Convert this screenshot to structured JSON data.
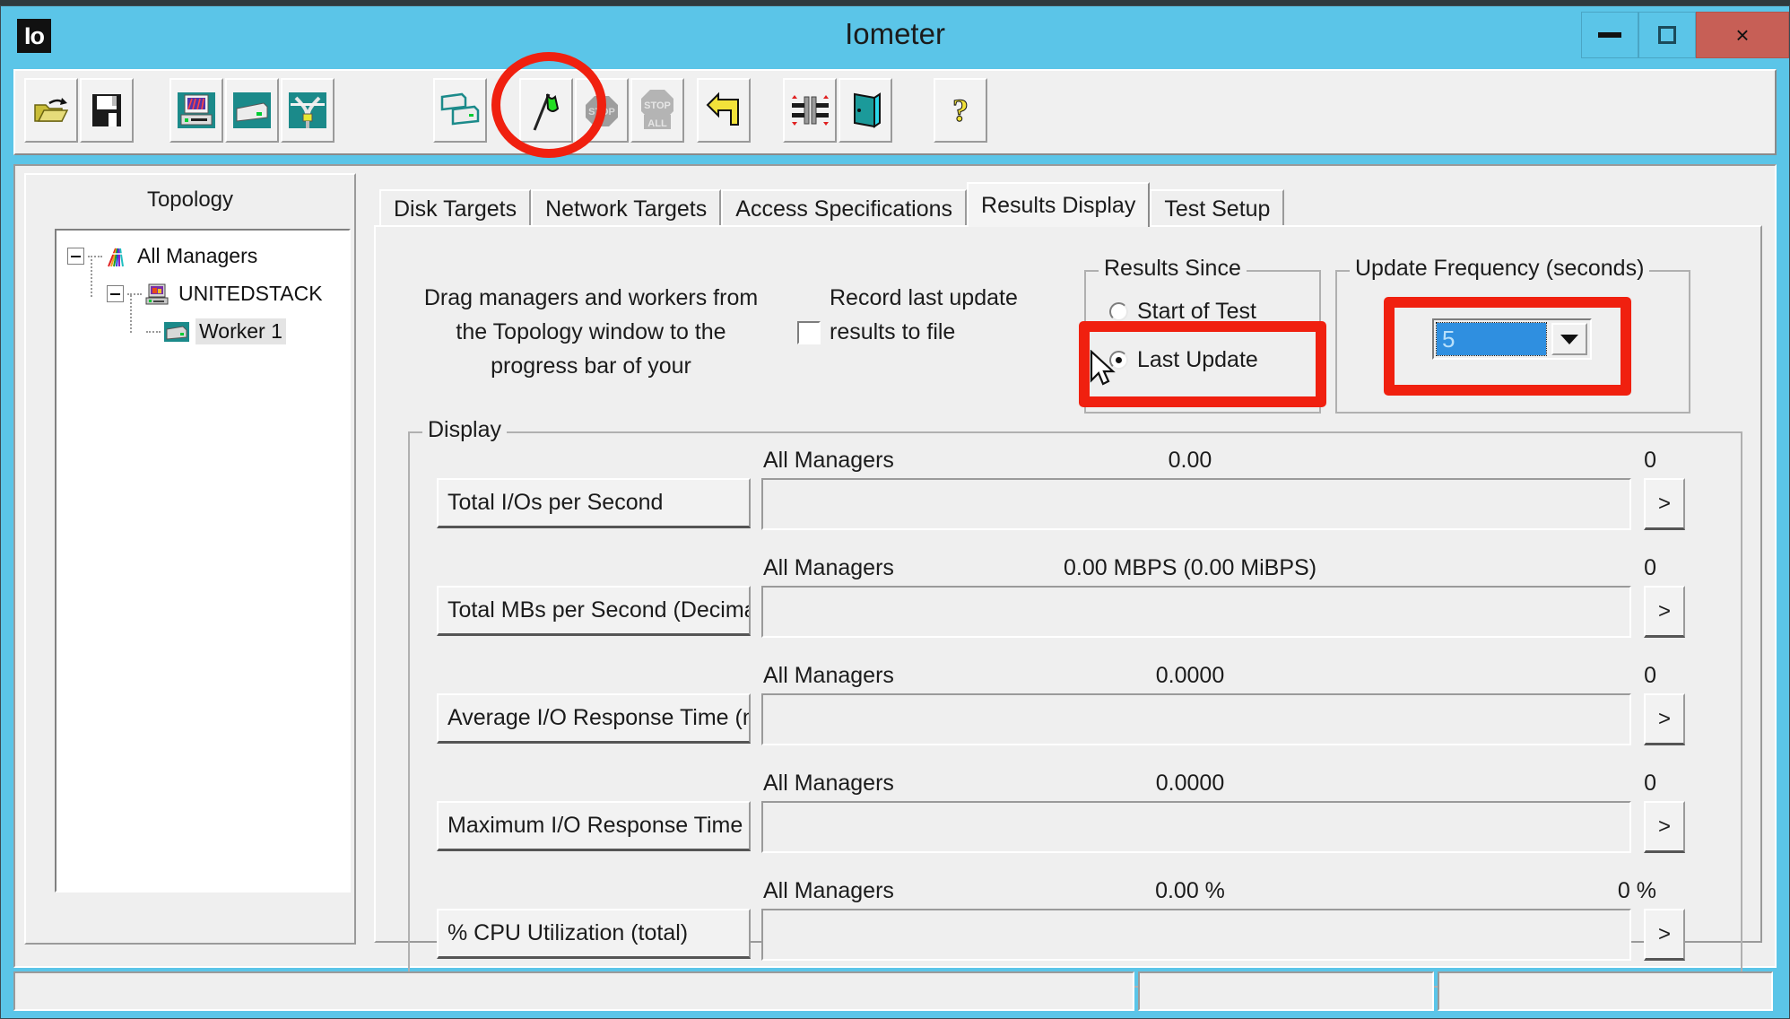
{
  "window": {
    "title": "Iometer",
    "app_icon": "Io",
    "controls": {
      "minimize": "minimize-icon",
      "maximize": "maximize-icon",
      "close": "×"
    }
  },
  "toolbar": {
    "buttons": [
      {
        "name": "open-config-icon",
        "label": "Open Test Configuration"
      },
      {
        "name": "save-config-icon",
        "label": "Save Test Configuration"
      },
      {
        "name": "new-manager-icon",
        "label": "Start New Manager"
      },
      {
        "name": "new-worker-icon",
        "label": "Start New Worker"
      },
      {
        "name": "disconnect-icon",
        "label": "Disconnect Selected Worker"
      },
      {
        "name": "duplicate-worker-icon",
        "label": "Duplicate Selected Worker"
      },
      {
        "name": "start-tests-icon",
        "label": "Start Tests"
      },
      {
        "name": "stop-test-icon",
        "label": "STOP"
      },
      {
        "name": "stop-all-icon",
        "label": "STOP ALL"
      },
      {
        "name": "reset-icon",
        "label": "Reset Workers"
      },
      {
        "name": "swap-icon",
        "label": "Swap"
      },
      {
        "name": "exit-icon",
        "label": "Exit"
      },
      {
        "name": "help-icon",
        "label": "?"
      }
    ]
  },
  "topology": {
    "title": "Topology",
    "nodes": [
      {
        "label": "All Managers",
        "icon": "all-managers-icon",
        "expanded": true,
        "selected": false,
        "depth": 0
      },
      {
        "label": "UNITEDSTACK",
        "icon": "manager-icon",
        "expanded": true,
        "selected": false,
        "depth": 1
      },
      {
        "label": "Worker 1",
        "icon": "worker-icon",
        "expanded": false,
        "selected": true,
        "depth": 2
      }
    ]
  },
  "tabs": [
    {
      "label": "Disk Targets",
      "active": false
    },
    {
      "label": "Network Targets",
      "active": false
    },
    {
      "label": "Access Specifications",
      "active": false
    },
    {
      "label": "Results Display",
      "active": true
    },
    {
      "label": "Test Setup",
      "active": false
    }
  ],
  "results_display": {
    "hint_text": "Drag managers and workers from the Topology window to the progress bar of your",
    "record_checkbox": {
      "label": "Record last update results to file",
      "checked": false
    },
    "results_since": {
      "title": "Results Since",
      "options": [
        {
          "label": "Start of Test",
          "selected": false
        },
        {
          "label": "Last Update",
          "selected": true
        }
      ]
    },
    "update_frequency": {
      "title": "Update Frequency (seconds)",
      "value": "5"
    },
    "display": {
      "title": "Display",
      "more_button": ">",
      "rows": [
        {
          "name": "Total I/Os per Second",
          "scope": "All Managers",
          "value": "0.00",
          "max": "0"
        },
        {
          "name": "Total MBs per Second (Decimal)",
          "scope": "All Managers",
          "value": "0.00 MBPS (0.00 MiBPS)",
          "max": "0"
        },
        {
          "name": "Average I/O Response Time (ms)",
          "scope": "All Managers",
          "value": "0.0000",
          "max": "0"
        },
        {
          "name": "Maximum I/O Response Time (ms",
          "scope": "All Managers",
          "value": "0.0000",
          "max": "0"
        },
        {
          "name": "% CPU Utilization (total)",
          "scope": "All Managers",
          "value": "0.00 %",
          "max": "0 %"
        }
      ]
    }
  },
  "status_bar": {
    "panel1": "",
    "panel2": "",
    "panel3": ""
  },
  "annotations": {
    "accent_color": "#f0200f",
    "highlights": [
      {
        "name": "start-tests-highlight",
        "shape": "oval"
      },
      {
        "name": "last-update-highlight",
        "shape": "rect"
      },
      {
        "name": "update-frequency-highlight",
        "shape": "rect"
      }
    ]
  },
  "colors": {
    "titlebar": "#5bc5e8",
    "close_button": "#c75f56",
    "face": "#efefef",
    "combo_selection": "#2f8fe0",
    "annotation": "#f0200f"
  }
}
